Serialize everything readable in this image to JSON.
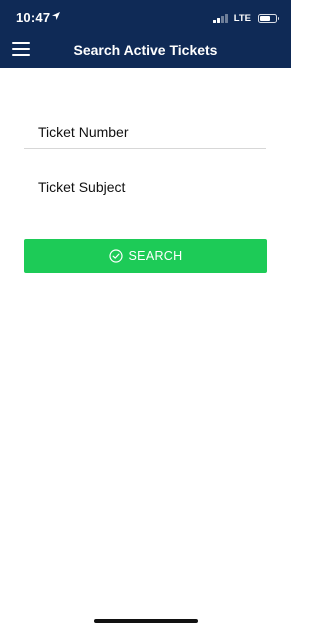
{
  "status_bar": {
    "time": "10:47",
    "network": "LTE",
    "signal_bars_active": 2,
    "signal_bars_total": 4,
    "battery_level": 0.6,
    "icons": [
      "location-arrow-icon",
      "signal-icon",
      "battery-icon"
    ]
  },
  "header": {
    "title": "Search Active Tickets",
    "menu_icon": "hamburger-menu-icon",
    "background_color": "#0f2a56"
  },
  "form": {
    "ticket_number": {
      "placeholder": "Ticket Number",
      "value": ""
    },
    "ticket_subject": {
      "placeholder": "Ticket Subject",
      "value": ""
    },
    "search_button": {
      "label": "SEARCH",
      "icon": "check-circle-icon",
      "color": "#1dcb57"
    }
  }
}
